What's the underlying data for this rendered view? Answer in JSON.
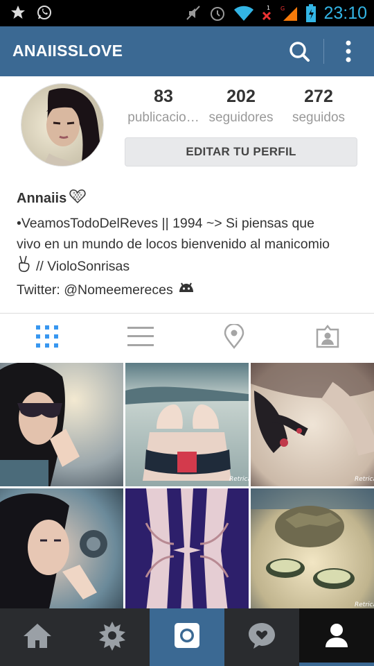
{
  "status_bar": {
    "time": "23:10",
    "icons": [
      "star-icon",
      "whatsapp-icon",
      "mute-icon",
      "alarm-icon",
      "wifi-icon",
      "no-signal-icon",
      "signal-icon",
      "battery-icon"
    ]
  },
  "app_bar": {
    "title": "ANAIISSLOVE",
    "icons": [
      "search-icon",
      "overflow-menu-icon"
    ]
  },
  "profile": {
    "stats": [
      {
        "count": "83",
        "label": "publicacio…"
      },
      {
        "count": "202",
        "label": "seguidores"
      },
      {
        "count": "272",
        "label": "seguidos"
      }
    ],
    "edit_button": "EDITAR TU PERFIL"
  },
  "bio": {
    "name": "Annaiis",
    "lines": [
      "•VeamosTodoDelReves || 1994 ~> Si piensas que",
      "vivo en un mundo de locos bienvenido al manicomio",
      "// VioloSonrisas",
      "Twitter: @Nomeemereces"
    ]
  },
  "tabs": [
    {
      "icon": "grid-view-icon",
      "active": true
    },
    {
      "icon": "list-view-icon",
      "active": false
    },
    {
      "icon": "map-pin-icon",
      "active": false
    },
    {
      "icon": "tagged-photos-icon",
      "active": false
    }
  ],
  "grid": {
    "watermark": "Retrica"
  },
  "bottom_nav": [
    {
      "icon": "home-icon"
    },
    {
      "icon": "explore-icon"
    },
    {
      "icon": "camera-icon"
    },
    {
      "icon": "activity-heart-icon"
    },
    {
      "icon": "profile-icon"
    }
  ],
  "colors": {
    "app_bar": "#3b6993",
    "status_time": "#33b5e5",
    "active_tab": "#3897f0",
    "bottom_nav": "#2a2c2f"
  }
}
